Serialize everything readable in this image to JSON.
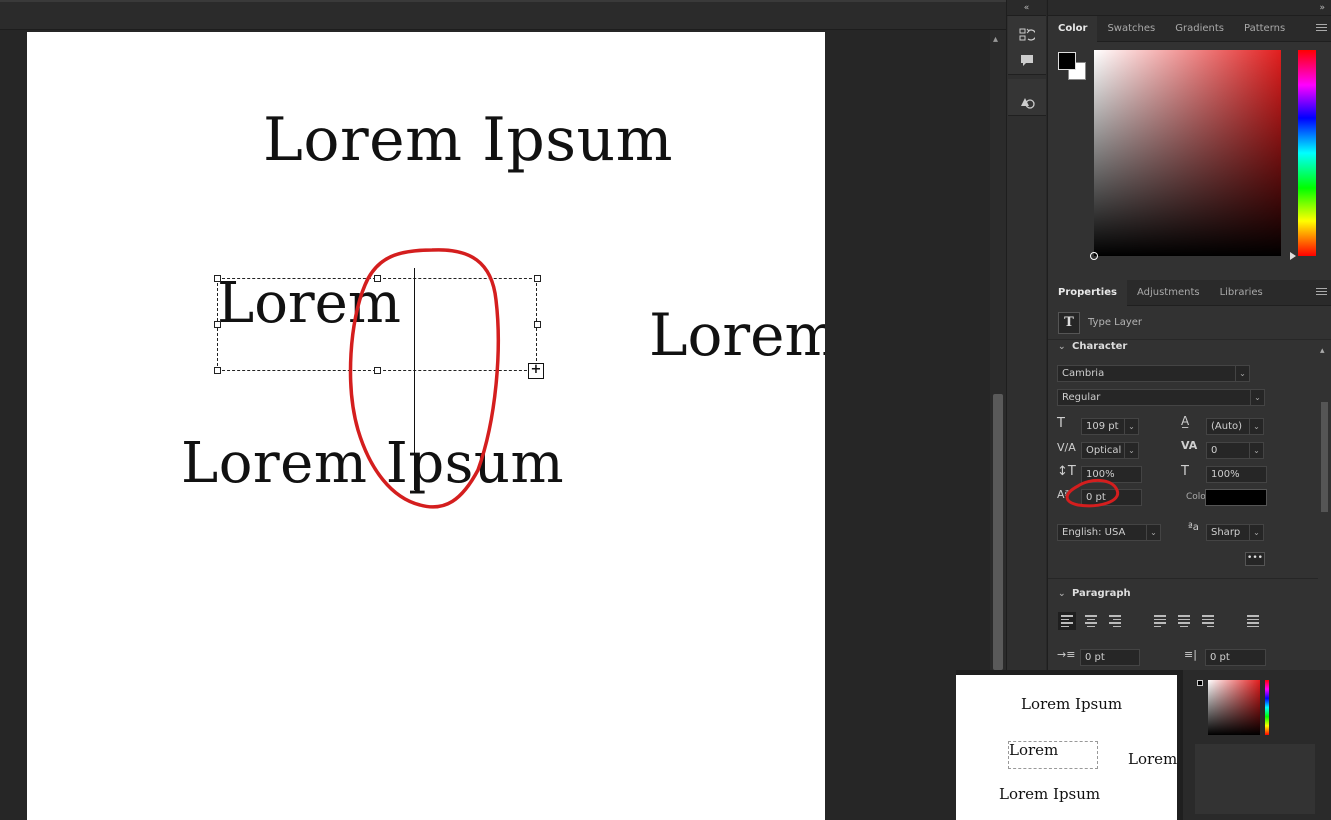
{
  "toolstrip": {
    "collapse_glyph": "«"
  },
  "panels": {
    "collapse_glyph": "»"
  },
  "color_panel": {
    "tabs": [
      "Color",
      "Swatches",
      "Gradients",
      "Patterns"
    ],
    "foreground": "#000000",
    "background": "#ffffff"
  },
  "properties_panel": {
    "tabs": [
      "Properties",
      "Adjustments",
      "Libraries"
    ],
    "layer_type": "Type Layer",
    "character": {
      "heading": "Character",
      "font_family": "Cambria",
      "font_style": "Regular",
      "font_size": "109 pt",
      "leading": "(Auto)",
      "kerning": "Optical",
      "tracking": "0",
      "vertical_scale": "100%",
      "horizontal_scale": "100%",
      "baseline_shift": "0 pt",
      "color_label": "Color",
      "language": "English: USA",
      "antialias": "Sharp"
    },
    "paragraph": {
      "heading": "Paragraph",
      "indent_left": "0 pt",
      "indent_right": "0 pt"
    }
  },
  "canvas": {
    "texts": [
      "Lorem Ipsum",
      "Lorem",
      "Lorem Ipsum",
      "Lorem"
    ]
  },
  "thumbnail": {
    "texts": [
      "Lorem Ipsum",
      "Lorem",
      "Lorem",
      "Lorem Ipsum"
    ]
  },
  "colors": {
    "annotation": "#d41e1e",
    "accent_red": "#e21e1e"
  }
}
